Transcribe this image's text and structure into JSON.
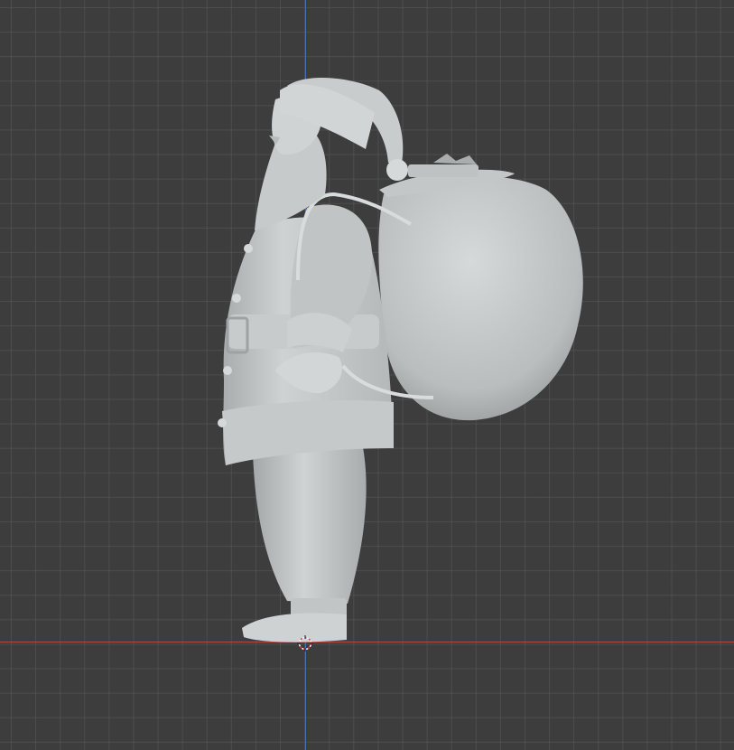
{
  "viewport": {
    "background": "#3d3d3d",
    "grid_color": "#555555",
    "axis_x_color": "#b34a4a",
    "axis_z_color": "#4a6fb3"
  },
  "scene": {
    "object_icon": "santa-claus-with-sack-model",
    "shading": "solid",
    "model_color": "#c8cbcc"
  },
  "cursor": {
    "icon": "3d-cursor-icon",
    "ring_colors": [
      "#e04040",
      "#ffffff"
    ]
  }
}
